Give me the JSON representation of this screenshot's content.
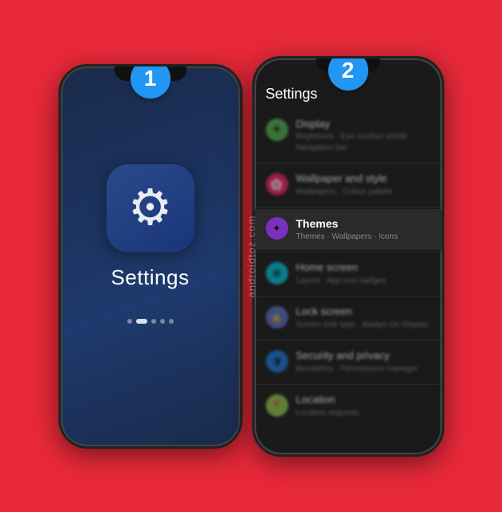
{
  "watermark": "androidtoz.com",
  "badge1": "1",
  "badge2": "2",
  "phone1": {
    "settings_label": "Settings",
    "dots": [
      false,
      true,
      false,
      false,
      false
    ]
  },
  "phone2": {
    "header": "Settings",
    "items": [
      {
        "title": "Display",
        "subtitle": "Brightness · Eye comfort shield · Navigation bar",
        "icon_color": "green",
        "icon_char": "☀",
        "blurred": true
      },
      {
        "title": "Wallpaper and style",
        "subtitle": "Wallpapers · Colour palette",
        "icon_color": "pink",
        "icon_char": "🖼",
        "blurred": true
      },
      {
        "title": "Themes",
        "subtitle": "Themes · Wallpapers · Icons",
        "icon_color": "purple",
        "icon_char": "✦",
        "blurred": false,
        "highlighted": true
      },
      {
        "title": "Home screen",
        "subtitle": "Layout · App icon badges",
        "icon_color": "teal",
        "icon_char": "⊞",
        "blurred": true
      },
      {
        "title": "Lock screen",
        "subtitle": "Screen lock type · Always On Display",
        "icon_color": "indigo",
        "icon_char": "🔒",
        "blurred": true
      },
      {
        "title": "Security and privacy",
        "subtitle": "Biometrics · Permissions manager",
        "icon_color": "blue",
        "icon_char": "🛡",
        "blurred": true
      },
      {
        "title": "Location",
        "subtitle": "Location requests",
        "icon_color": "lime",
        "icon_char": "📍",
        "blurred": true
      }
    ]
  }
}
